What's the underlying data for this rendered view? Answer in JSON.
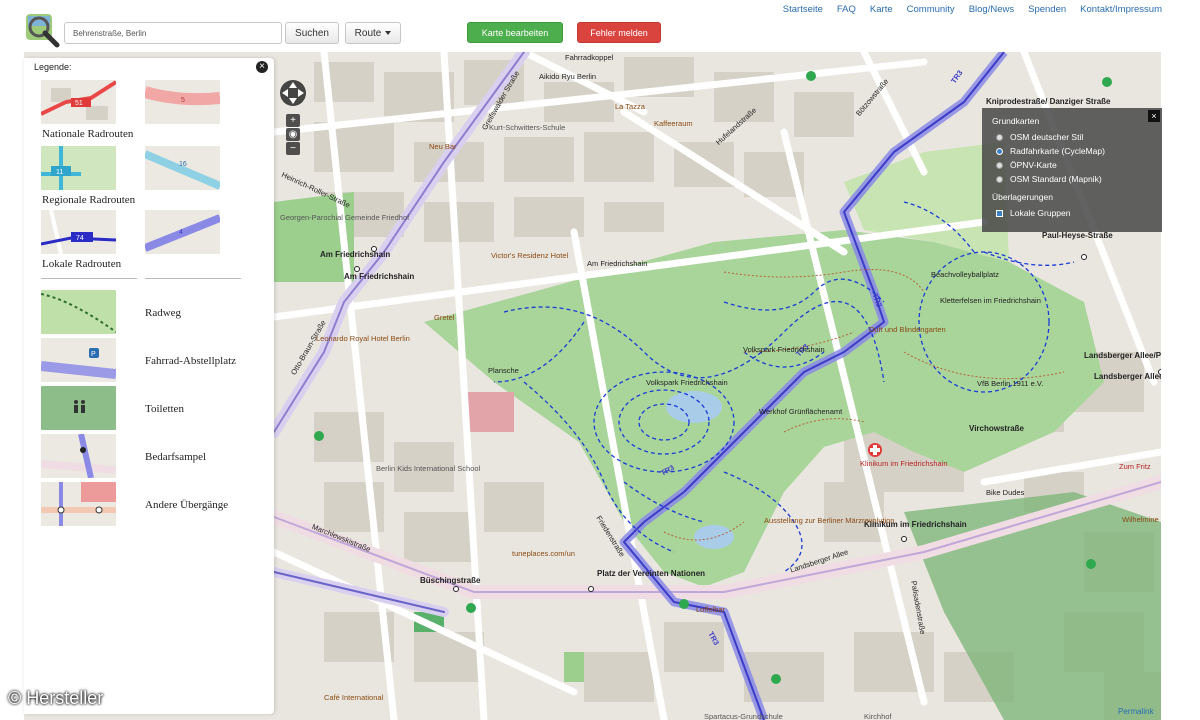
{
  "search": {
    "placeholder": "Behrenstraße, Berlin",
    "value": "Behrenstraße, Berlin"
  },
  "toolbar": {
    "search_label": "Suchen",
    "route_label": "Route",
    "edit_label": "Karte bearbeiten",
    "report_label": "Fehler melden"
  },
  "nav": [
    "Startseite",
    "FAQ",
    "Karte",
    "Community",
    "Blog/News",
    "Spenden",
    "Kontakt/Impressum"
  ],
  "legend": {
    "title": "Legende:",
    "categories": [
      "Nationale Radrouten",
      "Regionale Radrouten",
      "Lokale Radrouten"
    ],
    "items": [
      "Radweg",
      "Fahrrad-Abstellplatz",
      "Toiletten",
      "Bedarfsampel",
      "Andere Übergänge"
    ],
    "thumb_labels": [
      "51",
      "5",
      "11",
      "16",
      "74",
      "4"
    ]
  },
  "layers": {
    "base_header": "Grundkarten",
    "base": [
      {
        "label": "OSM deutscher Stil",
        "selected": false
      },
      {
        "label": "Radfahrkarte (CycleMap)",
        "selected": true
      },
      {
        "label": "ÖPNV-Karte",
        "selected": false
      },
      {
        "label": "OSM Standard (Mapnik)",
        "selected": false
      }
    ],
    "overlay_header": "Überlagerungen",
    "overlays": [
      {
        "label": "Lokale Gruppen",
        "checked": true
      }
    ]
  },
  "map": {
    "route_label": "TR3",
    "streets": [
      "Kniprodestraße/ Danziger Straße",
      "Paul-Heyse-Straße",
      "Am Friedrichshain",
      "Landsberger Allee/Petersburger",
      "Landsberger Allee",
      "Virchowstraße",
      "Klinikum im Friedrichshain",
      "Platz der Vereinten Nationen",
      "Büschingstraße",
      "Fahrradkoppel",
      "Am Friedrichshain",
      "Friedenstraße",
      "Landsberger Allee",
      "Palisadenstraße",
      "Marchlewskistraße",
      "Heinrich-Roller-Straße",
      "Greifswalder Straße",
      "Otto-Braun-Straße",
      "Hufelandstraße",
      "Bötzowstraße"
    ],
    "places": [
      "Volkspark Friedrichshain",
      "Volkspark Friedrichshain",
      "Werkhof Grünflächenamt",
      "Beachvolleyballplatz",
      "Kletterfelsen im Friedrichshain",
      "Planschе",
      "Gretel",
      "Duft und Blindengarten",
      "Klinikum im Friedrichshain",
      "Bike Dudes",
      "Ausstellung zur Berliner Märzrevolution",
      "Victor's Residenz Hotel",
      "Leonardo Royal Hotel Berlin",
      "Café International",
      "Loffelbar",
      "Kaffeeraum",
      "La Tazza",
      "Neu Bar",
      "Aikido Ryu Berlin",
      "VfB Berlin 1911 e.V.",
      "Berlin Kids International School",
      "Kurt-Schwitters-Schule",
      "Zum Fritz",
      "Wilhelmine",
      "tuneplaces.com/un",
      "Am Friedrichshain",
      "Georgen-Parochial Gemeinde Friedhof",
      "Spartacus-Grundschule",
      "Kirchhof"
    ]
  },
  "credit": "© Hersteller",
  "permalink": "Permalink",
  "colors": {
    "green_button": "#4cae4c",
    "red_button": "#d9443f",
    "route": "#6b6bd8",
    "park": "#a9d59b",
    "path": "#1a3bd6"
  }
}
